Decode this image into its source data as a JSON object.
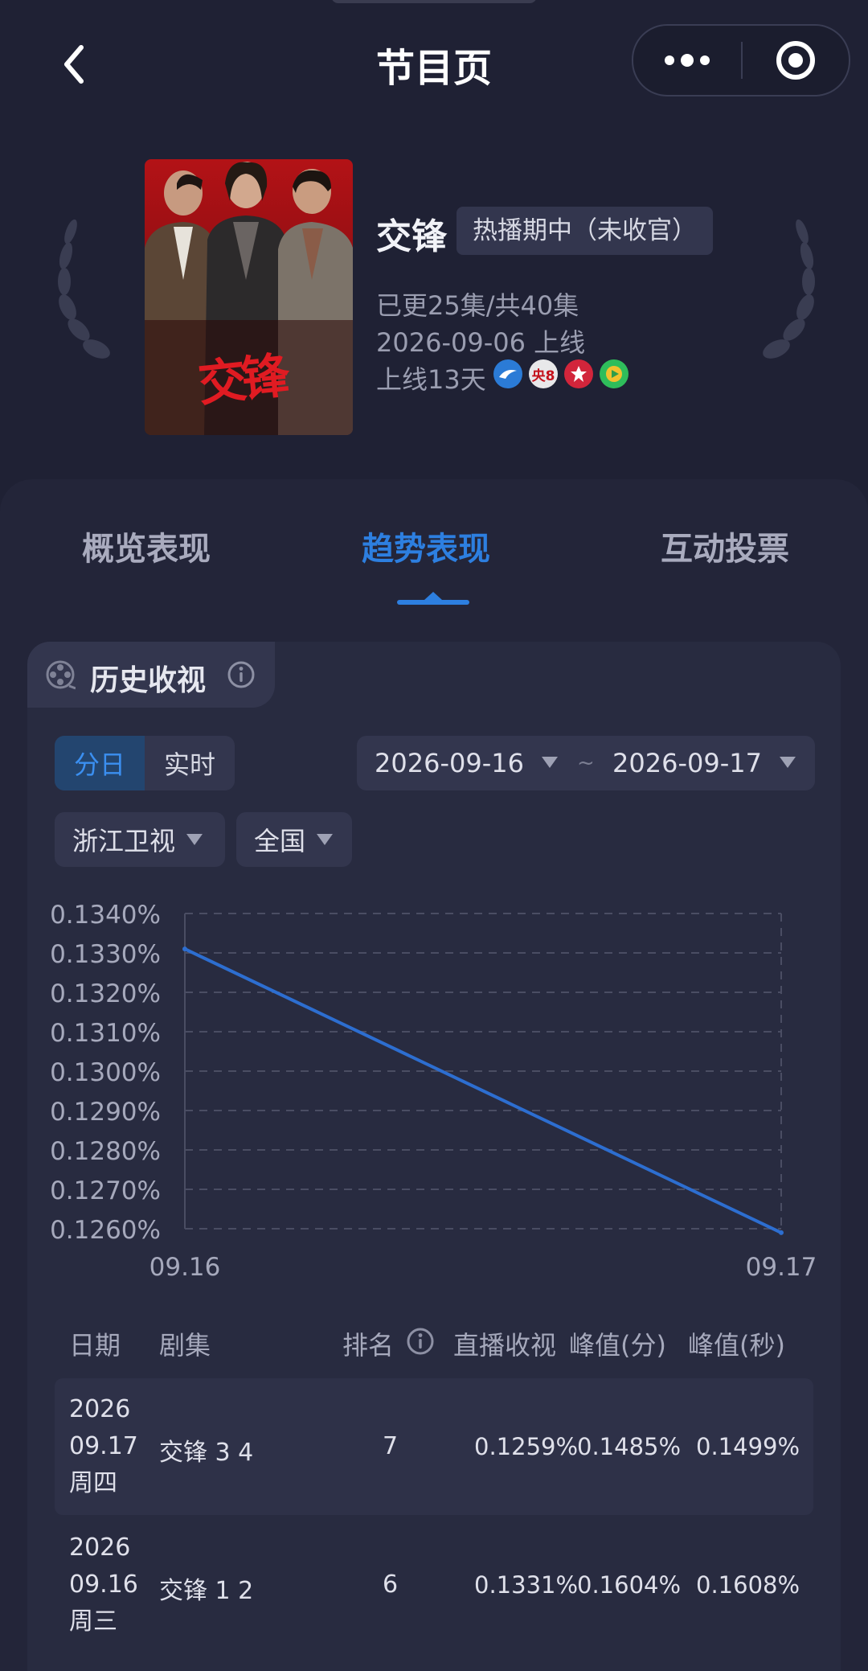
{
  "nav": {
    "title": "节目页"
  },
  "show": {
    "name": "交锋",
    "status": "热播期中（未收官）",
    "episodes": "已更25集/共40集",
    "premiere": "2026-09-06 上线",
    "days_online": "上线13天",
    "poster_title": "交锋",
    "platforms": [
      {
        "icon": "zhejiang-tv-icon",
        "color": "#2b7bd6"
      },
      {
        "icon": "cctv8-icon",
        "label": "央8",
        "color": "#e8e8ea"
      },
      {
        "icon": "dragon-tv-icon",
        "color": "#d2253b"
      },
      {
        "icon": "iqiyi-play-icon",
        "color": "#2fbd5b"
      }
    ]
  },
  "tabs": [
    {
      "label": "概览表现",
      "active": false
    },
    {
      "label": "趋势表现",
      "active": true
    },
    {
      "label": "互动投票",
      "active": false
    }
  ],
  "section": {
    "title": "历史收视"
  },
  "controls": {
    "mode_daily": "分日",
    "mode_realtime": "实时",
    "active_mode": "分日",
    "date_start": "2026-09-16",
    "date_sep": "~",
    "date_end": "2026-09-17",
    "channel": "浙江卫视",
    "region": "全国"
  },
  "chart_data": {
    "type": "line",
    "x": [
      "09.16",
      "09.17"
    ],
    "series": [
      {
        "values": [
          0.1331,
          0.1259
        ],
        "color": "#2d6ed0"
      }
    ],
    "ylim": [
      0.126,
      0.134
    ],
    "yticks": [
      "0.1340%",
      "0.1330%",
      "0.1320%",
      "0.1310%",
      "0.1300%",
      "0.1290%",
      "0.1280%",
      "0.1270%",
      "0.1260%"
    ],
    "grid": true,
    "title": "",
    "xlabel": "",
    "ylabel": ""
  },
  "table": {
    "headers": {
      "date": "日期",
      "episode": "剧集",
      "rank": "排名",
      "live": "直播收视",
      "peak_min": "峰值(分)",
      "peak_sec": "峰值(秒)"
    },
    "rows": [
      {
        "year": "2026",
        "md": "09.17",
        "weekday": "周四",
        "episode": "交锋 3 4",
        "rank": "7",
        "live": "0.1259%",
        "peak_min": "0.1485%",
        "peak_sec": "0.1499%"
      },
      {
        "year": "2026",
        "md": "09.16",
        "weekday": "周三",
        "episode": "交锋 1 2",
        "rank": "6",
        "live": "0.1331%",
        "peak_min": "0.1604%",
        "peak_sec": "0.1608%"
      }
    ]
  }
}
